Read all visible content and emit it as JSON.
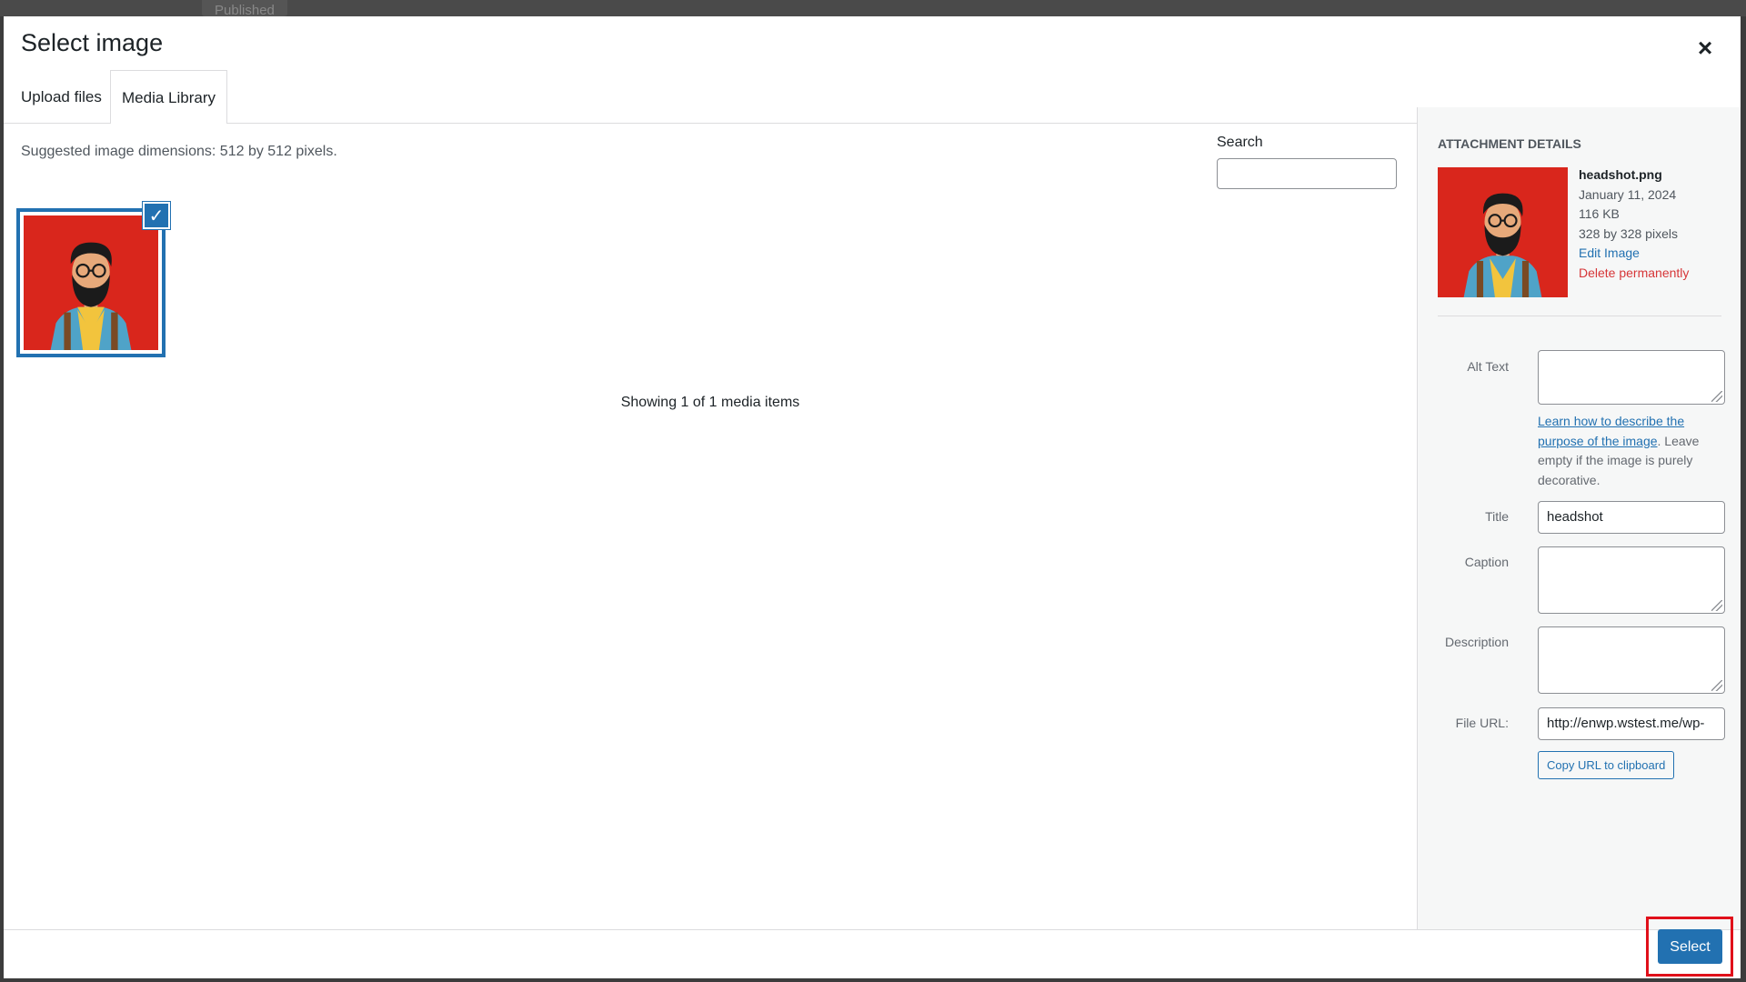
{
  "background": {
    "published_label": "Published"
  },
  "modal": {
    "title": "Select image",
    "close_label": "×"
  },
  "tabs": [
    {
      "label": "Upload files",
      "active": false
    },
    {
      "label": "Media Library",
      "active": true
    }
  ],
  "library": {
    "suggested": "Suggested image dimensions: 512 by 512 pixels.",
    "search_label": "Search",
    "search_value": "",
    "showing": "Showing 1 of 1 media items",
    "selected_check": "✓"
  },
  "details": {
    "heading": "Attachment Details",
    "filename": "headshot.png",
    "date": "January 11, 2024",
    "size": "116 KB",
    "dimensions": "328 by 328 pixels",
    "edit_link": "Edit Image",
    "delete_link": "Delete permanently",
    "alt_label": "Alt Text",
    "alt_value": "",
    "help_link": "Learn how to describe the purpose of the image",
    "help_rest": ". Leave empty if the image is purely decorative.",
    "title_label": "Title",
    "title_value": "headshot",
    "caption_label": "Caption",
    "caption_value": "",
    "description_label": "Description",
    "description_value": "",
    "url_label": "File URL:",
    "url_value": "http://enwp.wstest.me/wp-",
    "copy_button": "Copy URL to clipboard"
  },
  "footer": {
    "select_button": "Select"
  },
  "colors": {
    "accent": "#2271b1",
    "danger": "#d63638",
    "highlight": "#e0101a",
    "thumb_bg": "#d9261c"
  }
}
